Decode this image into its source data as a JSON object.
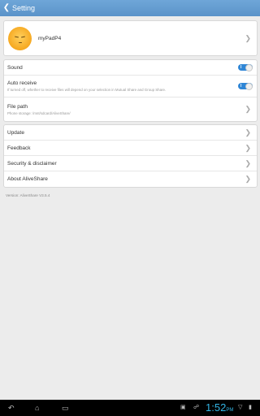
{
  "header": {
    "title": "Setting",
    "back_icon": "chevron-left-icon"
  },
  "profile": {
    "device_name": "myPadP4",
    "avatar_icon": "smiley-face-avatar"
  },
  "settings": {
    "sound": {
      "label": "Sound",
      "toggle": "on",
      "toggle_text": "I"
    },
    "auto_receive": {
      "label": "Auto receive",
      "description": "If turned off, whether to receive files will depend on your selection in Mutual Share and Group Share.",
      "toggle": "on",
      "toggle_text": "I"
    },
    "file_path": {
      "label": "File path",
      "description": "Phone storage: /mnt/sdcard/AliveShare/"
    }
  },
  "menu": {
    "items": [
      {
        "label": "Update"
      },
      {
        "label": "Feedback"
      },
      {
        "label": "Security & disclaimer"
      },
      {
        "label": "About AliveShare"
      }
    ]
  },
  "version": "Version: AliveShare V3.5.4",
  "system_bar": {
    "time": "1:52",
    "ampm": "PM"
  },
  "colors": {
    "header": "#5f9ad0",
    "toggle": "#2f86d6",
    "clock": "#33b5e5"
  }
}
